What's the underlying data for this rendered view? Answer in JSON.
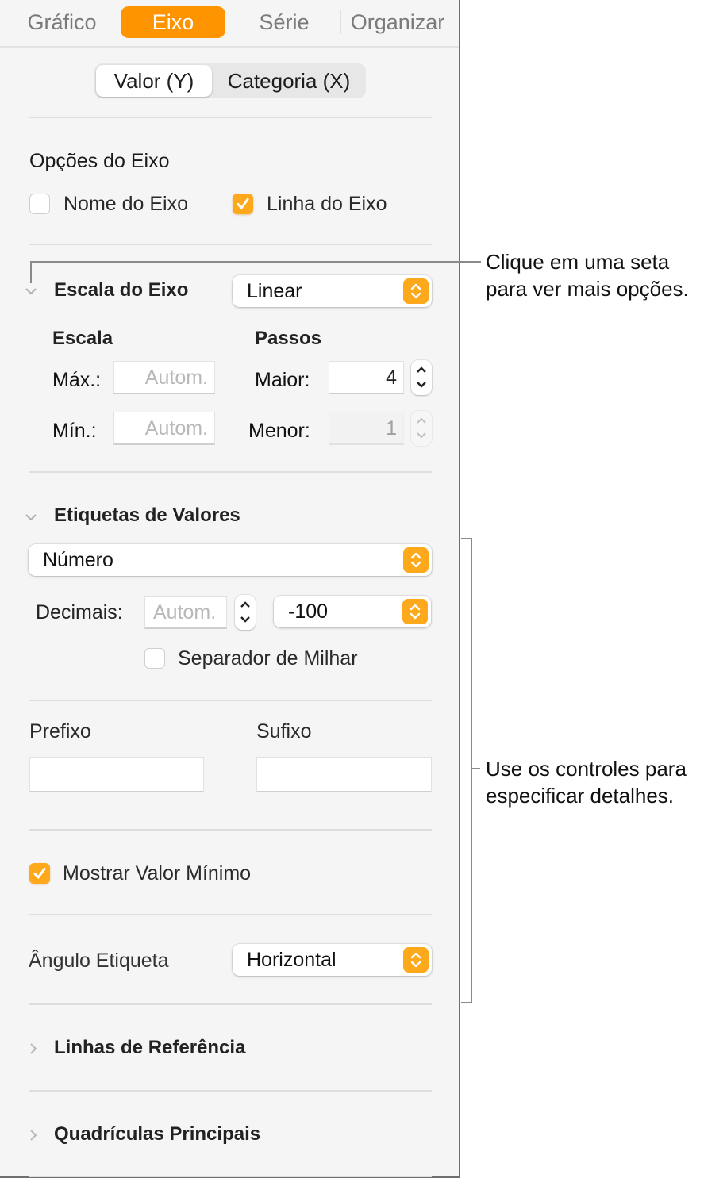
{
  "tabs": [
    {
      "label": "Gráfico",
      "active": false
    },
    {
      "label": "Eixo",
      "active": true
    },
    {
      "label": "Série",
      "active": false
    },
    {
      "label": "Organizar",
      "active": false
    }
  ],
  "axis_segment": {
    "options": [
      {
        "label": "Valor (Y)",
        "selected": true
      },
      {
        "label": "Categoria (X)",
        "selected": false
      }
    ]
  },
  "axis_options": {
    "title": "Opções do Eixo",
    "axis_name": {
      "label": "Nome do Eixo",
      "checked": false
    },
    "axis_line": {
      "label": "Linha do Eixo",
      "checked": true
    }
  },
  "axis_scale": {
    "title": "Escala do Eixo",
    "expanded": true,
    "scale_type": "Linear",
    "scale_header": "Escala",
    "steps_header": "Passos",
    "max_label": "Máx.:",
    "max_placeholder": "Autom.",
    "min_label": "Mín.:",
    "min_placeholder": "Autom.",
    "major_label": "Maior:",
    "major_value": "4",
    "minor_label": "Menor:",
    "minor_value": "1"
  },
  "value_labels": {
    "title": "Etiquetas de Valores",
    "expanded": true,
    "format": "Número",
    "decimals_label": "Decimais:",
    "decimals_placeholder": "Autom.",
    "negative_format": "-100",
    "thousands_separator": {
      "label": "Separador de Milhar",
      "checked": false
    },
    "prefix_label": "Prefixo",
    "prefix_value": "",
    "suffix_label": "Sufixo",
    "suffix_value": "",
    "show_minimum": {
      "label": "Mostrar Valor Mínimo",
      "checked": true
    },
    "label_angle_label": "Ângulo Etiqueta",
    "label_angle": "Horizontal"
  },
  "collapsed_sections": [
    {
      "title": "Linhas de Referência"
    },
    {
      "title": "Quadrículas Principais"
    }
  ],
  "callouts": {
    "arrow_hint": [
      "Clique em uma seta",
      "para ver mais opções."
    ],
    "controls_hint": [
      "Use os controles para",
      "especificar detalhes."
    ]
  },
  "colors": {
    "accent": "#fe9500",
    "checkbox_accent": "#fea81b",
    "panel_bg": "#f5f5f5"
  }
}
